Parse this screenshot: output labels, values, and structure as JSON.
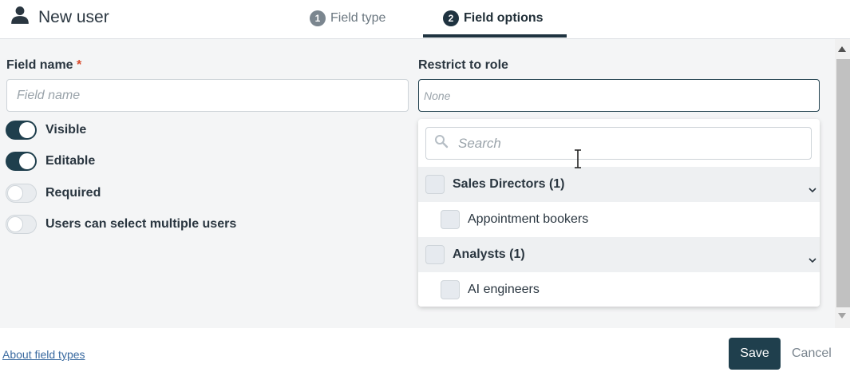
{
  "header": {
    "title": "New user",
    "steps": [
      {
        "num": "1",
        "label": "Field type"
      },
      {
        "num": "2",
        "label": "Field options"
      }
    ]
  },
  "form": {
    "field_name_label": "Field name",
    "field_name_required_mark": "*",
    "field_name_placeholder": "Field name",
    "restrict_label": "Restrict to role",
    "restrict_placeholder": "None",
    "toggles": [
      {
        "label": "Visible",
        "on": true
      },
      {
        "label": "Editable",
        "on": true
      },
      {
        "label": "Required",
        "on": false
      },
      {
        "label": "Users can select multiple users",
        "on": false
      }
    ]
  },
  "dropdown": {
    "search_placeholder": "Search",
    "groups": [
      {
        "label": "Sales Directors (1)",
        "items": [
          "Appointment bookers"
        ]
      },
      {
        "label": "Analysts (1)",
        "items": [
          "AI engineers"
        ]
      }
    ]
  },
  "footer": {
    "link": "About field types",
    "save": "Save",
    "cancel": "Cancel"
  },
  "colors": {
    "accent": "#1f3f4d",
    "required": "#d8492a",
    "link": "#3a6aa0"
  }
}
